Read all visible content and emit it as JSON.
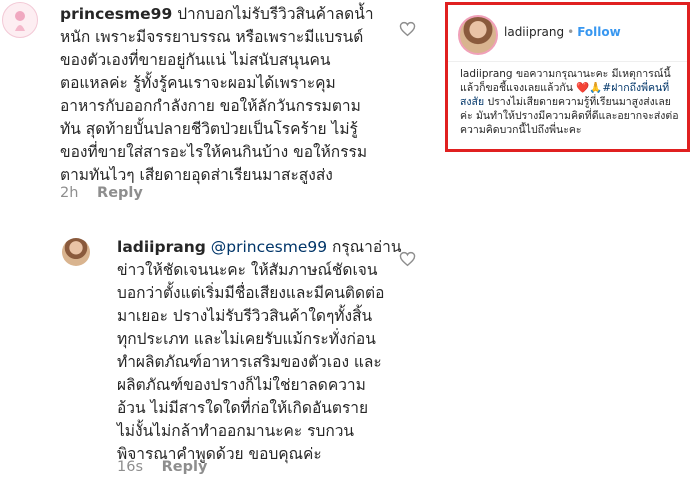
{
  "comment1": {
    "username": "princesme99",
    "lines": [
      "ปากบอกไม่รับรีวิวสินค้าลดน้ำ",
      "หนัก เพราะมีจรรยาบรรณ หรือเพราะมีแบรนด์",
      "ของตัวเองที่ขายอยู่กันแน่ ไม่สนับสนุนคน",
      "ตอแหลค่ะ รู้ทั้งรู้คนเราจะผอมได้เพราะคุม",
      "อาหารกับออกกำลังกาย ขอให้ลักวันกรรมตาม",
      "ทัน สุดท้ายบั้นปลายชีวิตป่วยเป็นโรคร้าย ไม่รู้",
      "ของที่ขายใส่สารอะไรให้คนกินบ้าง ขอให้กรรม",
      "ตามทันไวๆ เสียดายอุดส่าเรียนมาสะสูงส่ง"
    ],
    "time": "2h",
    "reply": "Reply"
  },
  "comment2": {
    "username": "ladiiprang",
    "mention": "@princesme99",
    "first_line_rest": "กรุณาอ่าน",
    "lines": [
      "ข่าวให้ชัดเจนนะคะ ให้สัมภาษณ์ชัดเจน",
      "บอกว่าตั้งแต่เริ่มมีชื่อเสียงและมีคนติดต่อ",
      "มาเยอะ ปรางไม่รับรีวิวสินค้าใดๆทั้งสิ้น",
      "ทุกประเภท และไม่เคยรับแม้กระทั่งก่อน",
      "ทำผลิตภัณฑ์อาหารเสริมของตัวเอง และ",
      "ผลิตภัณฑ์ของปรางก็ไม่ใช่ยาลดความ",
      "อ้วน ไม่มีสารใดใดที่ก่อให้เกิดอันตราย",
      "ไม่งั้นไม่กล้าทำออกมานะคะ รบกวน",
      "พิจารณาคำพูดด้วย ขอบคุณค่ะ"
    ],
    "time": "16s",
    "reply": "Reply"
  },
  "card": {
    "username": "ladiiprang",
    "dot": "•",
    "follow": "Follow",
    "caption_user": "ladiiprang",
    "caption_l1_rest": "ขอความกรุณานะคะ มีเหตุการณ์นี้",
    "caption_l2": "แล้วก็ขอชี้แจงเลยแล้วกัน",
    "caption_l2_emoji": "❤️🙏",
    "caption_l2_tag": "#ฝากถึงพี่คนที่",
    "caption_l3_tag": "สงสัย",
    "caption_l3_rest": "ปรางไม่เสียดายความรู้ที่เรียนมาสูงส่งเลย",
    "caption_l4": "ค่ะ มันทำให้ปรางมีความคิดที่ดีและอยากจะส่งต่อ",
    "caption_l5": "ความคิดบวกนี้ไปถึงพี่นะคะ"
  }
}
